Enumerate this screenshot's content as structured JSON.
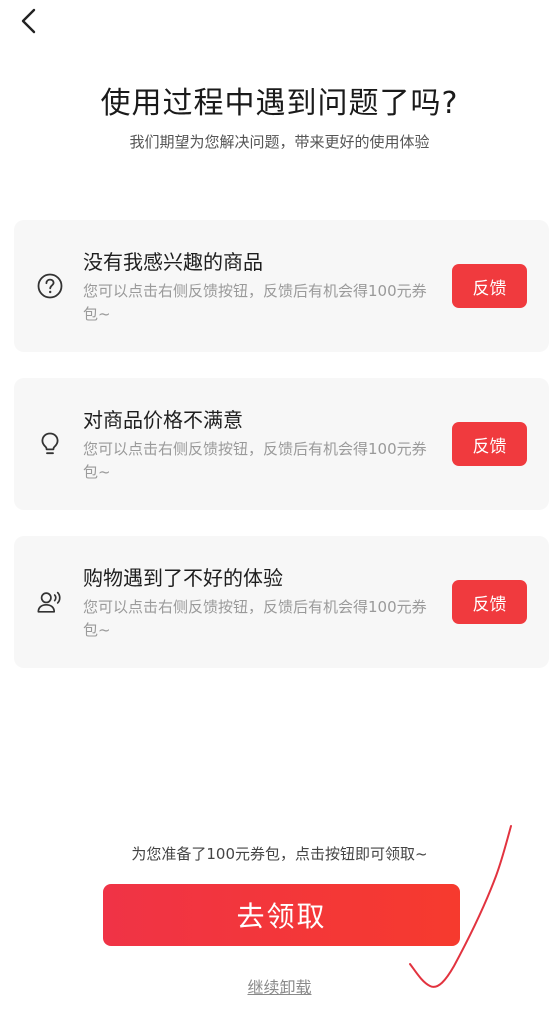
{
  "header": {
    "back_icon": "chevron-left-icon",
    "title": "使用过程中遇到问题了吗?",
    "subtitle": "我们期望为您解决问题，带来更好的使用体验"
  },
  "cards": [
    {
      "icon": "question-circle-icon",
      "title": "没有我感兴趣的商品",
      "desc": "您可以点击右侧反馈按钮，反馈后有机会得100元券包~",
      "button": "反馈"
    },
    {
      "icon": "lightbulb-icon",
      "title": "对商品价格不满意",
      "desc": "您可以点击右侧反馈按钮，反馈后有机会得100元券包~",
      "button": "反馈"
    },
    {
      "icon": "user-voice-icon",
      "title": "购物遇到了不好的体验",
      "desc": "您可以点击右侧反馈按钮，反馈后有机会得100元券包~",
      "button": "反馈"
    }
  ],
  "footer": {
    "promo_text": "为您准备了100元券包，点击按钮即可领取~",
    "claim_label": "去领取",
    "uninstall_label": "继续卸载"
  },
  "colors": {
    "accent": "#f03a3e",
    "card_bg": "#f7f7f7",
    "annotation": "#e2333f"
  }
}
